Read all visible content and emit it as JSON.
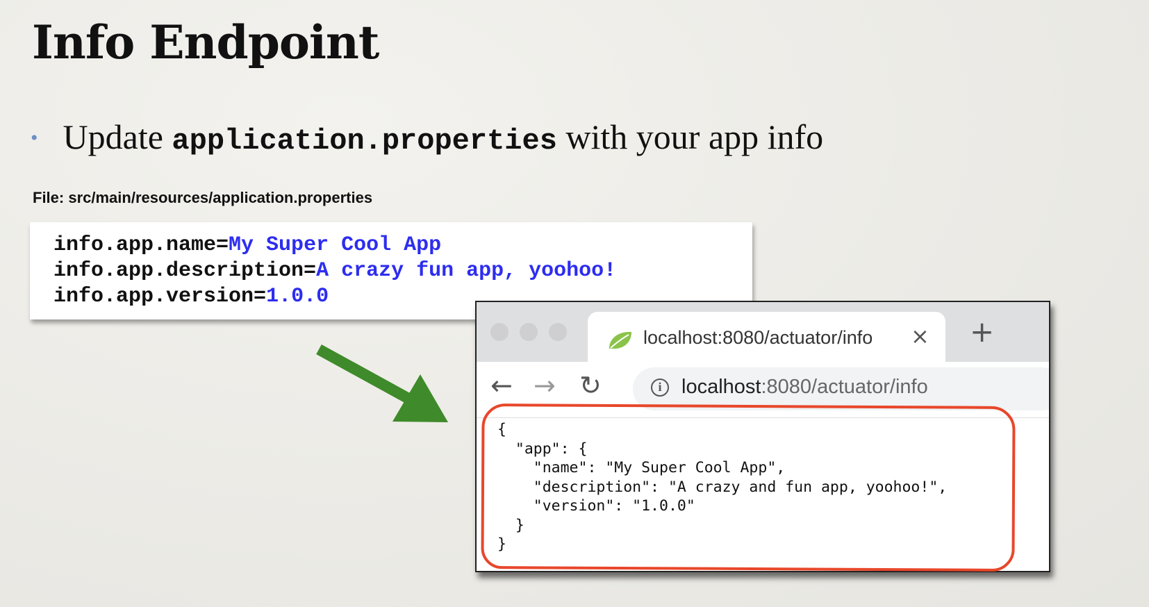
{
  "slide": {
    "title": "Info Endpoint",
    "bullet": {
      "marker": "•",
      "before": "Update ",
      "code": "application.properties",
      "after": " with your app info"
    },
    "file_label": "File: src/main/resources/application.properties"
  },
  "properties": [
    {
      "key": "info.app.name=",
      "value": "My Super Cool App"
    },
    {
      "key": "info.app.description=",
      "value": "A crazy fun app, yoohoo!"
    },
    {
      "key": "info.app.version=",
      "value": "1.0.0"
    }
  ],
  "browser": {
    "tab_title": "localhost:8080/actuator/info",
    "tab_close": "×",
    "new_tab": "+",
    "back": "←",
    "forward": "→",
    "reload": "↻",
    "info_icon": "i",
    "url_host": "localhost",
    "url_rest": ":8080/actuator/info",
    "json_lines": [
      "{",
      "  \"app\": {",
      "    \"name\": \"My Super Cool App\",",
      "    \"description\": \"A crazy and fun app, yoohoo!\",",
      "    \"version\": \"1.0.0\"",
      "  }",
      "}"
    ]
  },
  "colors": {
    "value_blue": "#2d2df0",
    "arrow_green": "#3f8a2a",
    "highlight_red": "#e8472b",
    "bullet_blue": "#6b8fc6"
  },
  "icons": [
    "leaf-favicon-icon",
    "close-icon",
    "plus-icon",
    "back-arrow-icon",
    "forward-arrow-icon",
    "reload-icon",
    "info-icon",
    "green-arrow-icon"
  ]
}
